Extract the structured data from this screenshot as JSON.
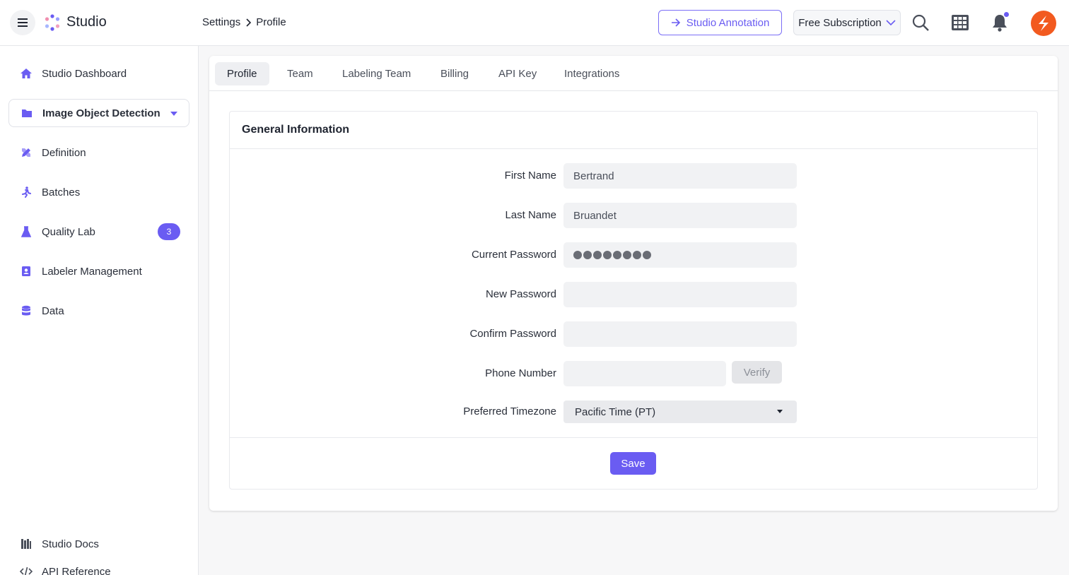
{
  "app": {
    "name": "Studio"
  },
  "breadcrumb": {
    "parent": "Settings",
    "current": "Profile"
  },
  "header": {
    "annotation_button": "Studio Annotation",
    "subscription_button": "Free Subscription",
    "icons": [
      "menu-icon",
      "search-icon",
      "apps-grid-icon",
      "bell-icon",
      "avatar"
    ]
  },
  "sidebar": {
    "items": [
      {
        "label": "Studio Dashboard",
        "icon": "home-icon"
      },
      {
        "label": "Image Object Detection",
        "icon": "folder-icon"
      },
      {
        "label": "Definition",
        "icon": "pencil-ruler-icon"
      },
      {
        "label": "Batches",
        "icon": "runner-icon"
      },
      {
        "label": "Quality Lab",
        "icon": "flask-icon",
        "badge": "3"
      },
      {
        "label": "Labeler Management",
        "icon": "contact-book-icon"
      },
      {
        "label": "Data",
        "icon": "database-icon"
      }
    ],
    "footer": [
      {
        "label": "Studio Docs",
        "icon": "books-icon"
      },
      {
        "label": "API Reference",
        "icon": "code-icon"
      }
    ]
  },
  "tabs": [
    "Profile",
    "Team",
    "Labeling Team",
    "Billing",
    "API Key",
    "Integrations"
  ],
  "form": {
    "title": "General Information",
    "first_name_label": "First Name",
    "first_name_value": "Bertrand",
    "last_name_label": "Last Name",
    "last_name_value": "Bruandet",
    "current_password_label": "Current Password",
    "current_password_masked_length": 8,
    "new_password_label": "New Password",
    "confirm_password_label": "Confirm Password",
    "phone_label": "Phone Number",
    "verify_button": "Verify",
    "timezone_label": "Preferred Timezone",
    "timezone_value": "Pacific Time (PT)",
    "save_button": "Save"
  },
  "colors": {
    "accent": "#6a5cf2",
    "avatar": "#f25a1f"
  }
}
